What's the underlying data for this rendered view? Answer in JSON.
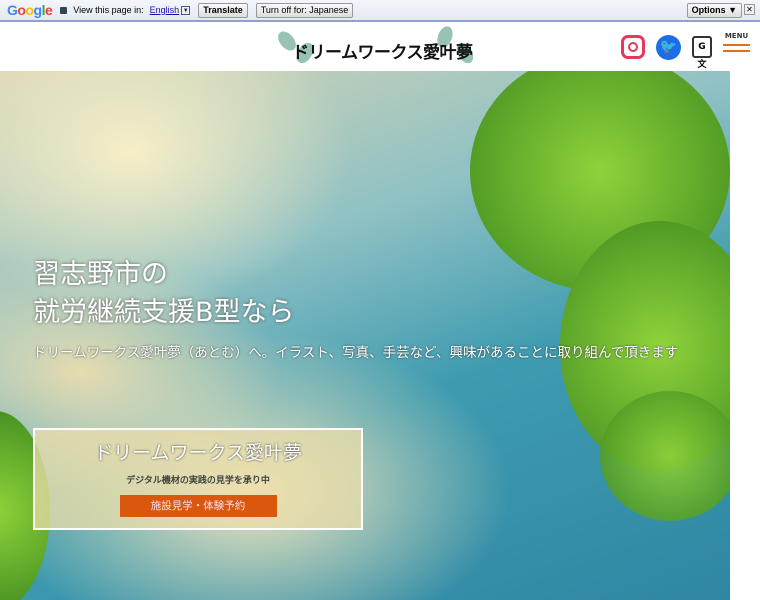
{
  "translate_bar": {
    "brand": "Google",
    "view_label": "View this page in:",
    "language": "English",
    "translate_button": "Translate",
    "turn_off_button": "Turn off for: Japanese",
    "options_button": "Options ▼",
    "close": "✕"
  },
  "header": {
    "logo_text": "ドリームワークス愛叶夢",
    "menu_label": "MENU",
    "twitter_glyph": "🐦",
    "translate_glyph": "G文"
  },
  "hero": {
    "title_line1": "習志野市の",
    "title_line2": "就労継続支援B型なら",
    "subtitle": "ドリームワークス愛叶夢（あとむ）へ。イラスト、写真、手芸など、興味があることに取り組んで頂きます"
  },
  "card": {
    "title": "ドリームワークス愛叶夢",
    "subtitle": "デジタル機材の実践の見学を承り中",
    "button": "施設見学・体験予約"
  },
  "colors": {
    "accent": "#d9580e",
    "menu": "#e07020",
    "twitter": "#1d6ee6",
    "instagram": "#e33a5a"
  }
}
